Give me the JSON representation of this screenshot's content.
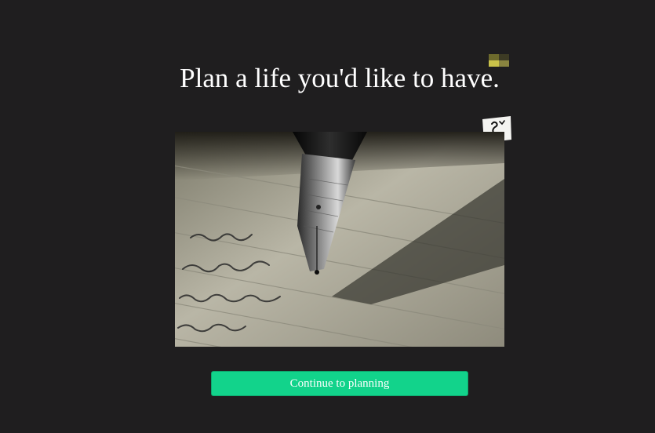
{
  "headline": "Plan a life you'd like to have.",
  "cta": {
    "label": "Continue to planning"
  },
  "hero_image": {
    "subject": "fountain-pen-writing-on-lined-paper"
  },
  "colors": {
    "background": "#1f1e1f",
    "title_text": "#ffffff",
    "cta_background": "#12d38b",
    "cta_text": "#ffffff"
  },
  "icons": {
    "badge": "yellow-pixel-badge-icon",
    "sticker": "sketch-sticker-icon"
  }
}
